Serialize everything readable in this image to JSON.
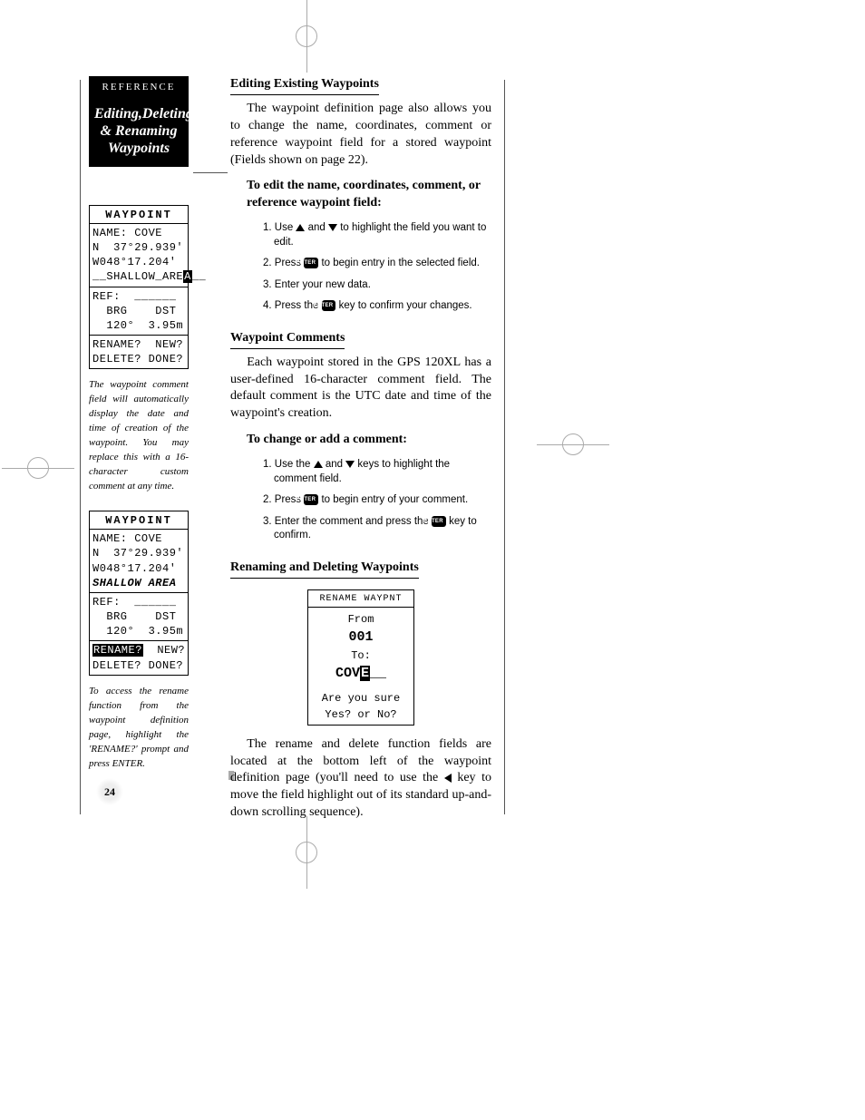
{
  "sidebar": {
    "ref_label": "REFERENCE",
    "title_html": "Editing,Deleting & Renaming Waypoints",
    "title_l1": "Editing,Deleting",
    "title_l2": "& Renaming",
    "title_l3": "Waypoints",
    "lcd1": {
      "header": "WAYPOINT",
      "name_row": "NAME: COVE",
      "lat": "N  37°29.939'",
      "lon": "W048°17.204'",
      "comment": "__SHALLOW_ARE",
      "comment_cursor": "A",
      "comment_tail": "__",
      "ref": "REF:  ______",
      "brg_hdr": "  BRG    DST",
      "brg_val": "  120°  3.95m",
      "bottom1": "RENAME?  NEW?",
      "bottom2": "DELETE? DONE?"
    },
    "caption1": "The waypoint comment field will automatically display the date and time of creation of the waypoint. You may replace this with a 16-character custom comment at any time.",
    "lcd2": {
      "header": "WAYPOINT",
      "name_row": "NAME: COVE",
      "lat": "N  37°29.939'",
      "lon": "W048°17.204'",
      "comment": "SHALLOW AREA",
      "ref": "REF:  ______",
      "brg_hdr": "  BRG    DST",
      "brg_val": "  120°  3.95m",
      "rename_inv": "RENAME?",
      "rename_tail": "  NEW?",
      "bottom2": "DELETE? DONE?"
    },
    "caption2": "To access the rename function from the waypoint definition page, highlight the 'RENAME?' prompt and press ENTER."
  },
  "page_number": "24",
  "main": {
    "h1": "Editing Existing Waypoints",
    "p1": "The waypoint definition page also allows you to change the name, coordinates, comment or reference waypoint field for a stored waypoint (Fields shown on page 22).",
    "lead1": "To edit the name, coordinates, comment, or reference waypoint field:",
    "s1_1a": "1. Use ",
    "s1_1b": " and ",
    "s1_1c": " to highlight the field you want to edit.",
    "s1_2a": "2. Press ",
    "s1_2b": " to begin entry in the selected field.",
    "s1_3": "3. Enter your new data.",
    "s1_4a": "4. Press the ",
    "s1_4b": " key to confirm your changes.",
    "h2": "Waypoint Comments",
    "p2": "Each waypoint stored in the GPS 120XL has a user-defined 16-character comment field. The default comment is the UTC date and time of the waypoint's creation.",
    "lead2": "To change or add a comment:",
    "s2_1a": "1. Use the ",
    "s2_1b": " and ",
    "s2_1c": " keys to highlight the comment field.",
    "s2_2a": "2. Press ",
    "s2_2b": " to begin entry of your comment.",
    "s2_3a": "3. Enter the comment and press the ",
    "s2_3b": " key to confirm.",
    "h3": "Renaming and Deleting Waypoints",
    "rename_lcd": {
      "header": "RENAME WAYPNT",
      "from": "From",
      "from_val": "001",
      "to": "To:",
      "to_val_pre": "COV",
      "to_val_cursor": "E",
      "to_val_post": "__",
      "q1": "Are you sure",
      "q2": "Yes? or No?"
    },
    "p3a": "The rename and delete function fields are located at the bottom left of the waypoint definition page (you'll need to use the ",
    "p3b": " key to move the field highlight out of its standard up-and-down scrolling sequence).",
    "enter_label": "ENTER"
  }
}
